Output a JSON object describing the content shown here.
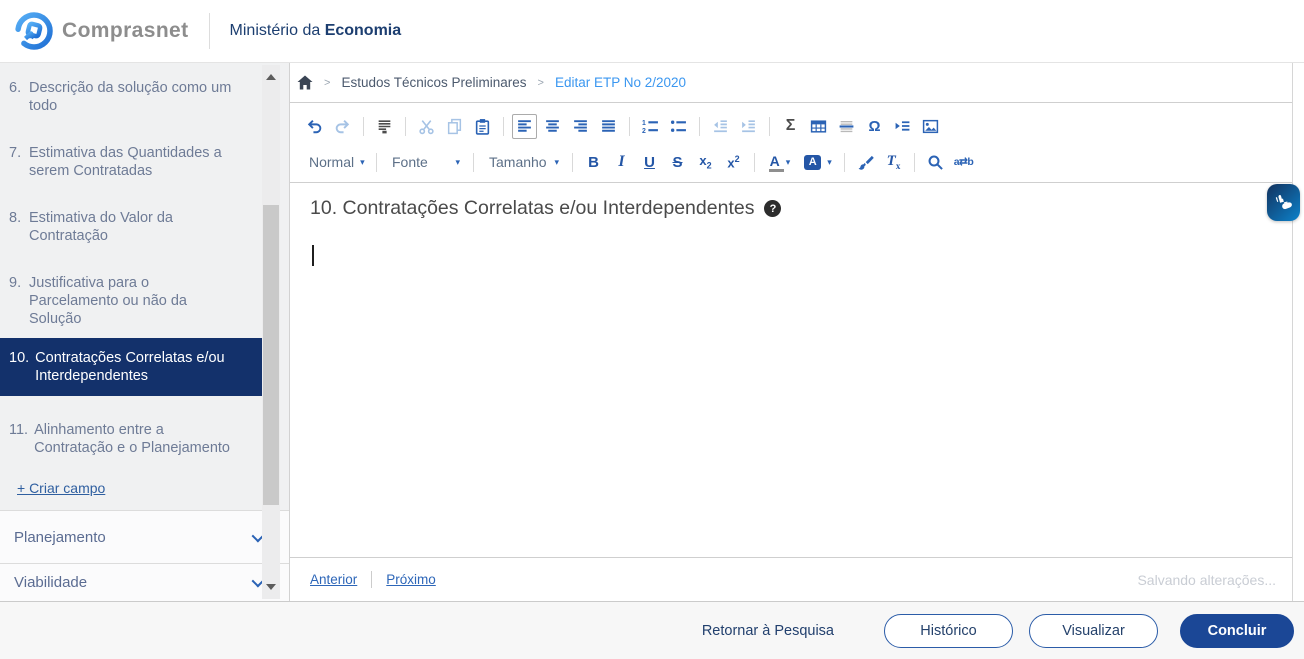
{
  "colors": {
    "accent_blue": "#2b63b5",
    "link_blue": "#3b97f0",
    "navy": "#1c3e70",
    "active_item_bg": "#13316b",
    "button_fill_blue": "#1b4796",
    "sidebar_text": "#6e7b96",
    "footer_bg": "#f7f7f7"
  },
  "header": {
    "brand": "Comprasnet",
    "ministry_prefix": "Ministério da",
    "ministry_name": "Economia"
  },
  "sidebar": {
    "items": [
      {
        "num": "6.",
        "label": "Descrição da solução como um todo"
      },
      {
        "num": "7.",
        "label": "Estimativa das Quantidades a serem Contratadas"
      },
      {
        "num": "8.",
        "label": "Estimativa do Valor da Contratação"
      },
      {
        "num": "9.",
        "label": "Justificativa para o Parcelamento ou não da Solução"
      },
      {
        "num": "10.",
        "label": "Contratações Correlatas e/ou Interdependentes"
      },
      {
        "num": "11.",
        "label": "Alinhamento entre a Contratação e o Planejamento"
      }
    ],
    "active_item_index": 4,
    "create_field_label": "+ Criar campo",
    "sections": [
      {
        "label": "Planejamento"
      },
      {
        "label": "Viabilidade"
      }
    ]
  },
  "breadcrumb": {
    "level1": "Estudos Técnicos Preliminares",
    "level2": "Editar ETP No 2/2020"
  },
  "toolbar": {
    "format_dropdown": "Normal",
    "font_dropdown": "Fonte",
    "size_dropdown": "Tamanho",
    "row1_icons": [
      "undo",
      "redo",
      "print",
      "cut",
      "copy",
      "paste",
      "align-left",
      "align-center",
      "align-right",
      "justify",
      "numbered-list",
      "bulleted-list",
      "decrease-indent",
      "increase-indent",
      "formula",
      "table",
      "horizontal-line",
      "special-character",
      "page-break",
      "image"
    ],
    "row1_disabled": [
      "redo",
      "cut",
      "copy",
      "decrease-indent",
      "increase-indent"
    ],
    "row1_active": [
      "align-left"
    ],
    "row2_icons": [
      "bold",
      "italic",
      "underline",
      "strikethrough",
      "subscript",
      "superscript",
      "text-color",
      "background-color",
      "copy-formatting",
      "remove-format",
      "find",
      "replace"
    ],
    "formula_glyph": "Σ",
    "special_char_glyph": "Ω",
    "bold_glyph": "B",
    "italic_glyph": "I",
    "underline_glyph": "U",
    "strike_glyph": "S",
    "sub_base": "x",
    "sub_index": "2",
    "sup_base": "x",
    "sup_exp": "2",
    "text_color_glyph": "A",
    "bg_color_glyph": "A",
    "remove_format_base": "T",
    "remove_format_sub": "x",
    "replace_glyph": "a⇄b"
  },
  "editor": {
    "heading": "10. Contratações Correlatas e/ou Interdependentes",
    "help_glyph": "?",
    "nav_previous": "Anterior",
    "nav_next": "Próximo",
    "status": "Salvando alterações..."
  },
  "footer": {
    "return_link": "Retornar à Pesquisa",
    "history_button": "Histórico",
    "preview_button": "Visualizar",
    "finish_button": "Concluir"
  },
  "icons": {
    "breadcrumb_sep": ">",
    "caret_down": "▾"
  }
}
